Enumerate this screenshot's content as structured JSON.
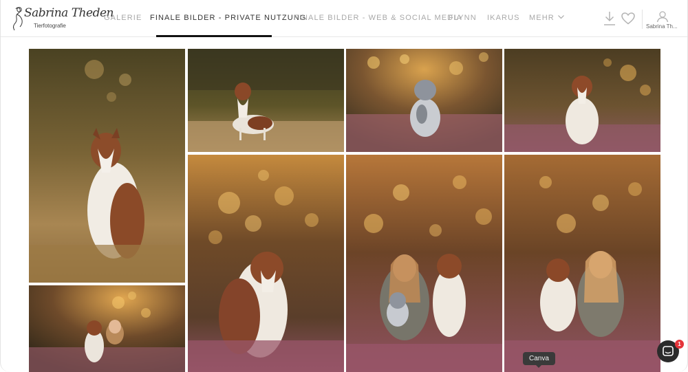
{
  "brand": {
    "name_script": "Sabrina Theden",
    "subtitle": "Tierfotografie"
  },
  "nav": {
    "items": [
      {
        "label": "GALERIE",
        "active": false
      },
      {
        "label": "FINALE BILDER - PRIVATE NUTZUNG",
        "active": true
      },
      {
        "label": "FINALE BILDER - WEB & SOCIAL MEDIA",
        "active": false
      },
      {
        "label": "FLYNN",
        "active": false
      },
      {
        "label": "IKARUS",
        "active": false
      },
      {
        "label": "MEHR",
        "active": false
      }
    ]
  },
  "header_actions": {
    "download_icon": "download-icon",
    "favorites_icon": "heart-icon",
    "user_icon": "user-icon",
    "user_name": "Sabrina Th..."
  },
  "colors": {
    "accent": "#111111",
    "nav_inactive": "#a8a8a8",
    "nav_active": "#333333",
    "chat_button": "#2b2b2b",
    "badge": "#e5343a"
  },
  "gallery": {
    "photos": [
      {
        "subject": "australian shepherd sitting in golden grass"
      },
      {
        "subject": "australian shepherd standing in meadow"
      },
      {
        "subject": "blue merle puppy in heather"
      },
      {
        "subject": "australian shepherd sitting in heather"
      },
      {
        "subject": "woman with dog in heather"
      },
      {
        "subject": "australian shepherd portrait with bokeh"
      },
      {
        "subject": "woman with puppy and dog in heather"
      },
      {
        "subject": "dog and woman sitting in heather"
      }
    ]
  },
  "tooltip": {
    "text": "Canva"
  },
  "chat": {
    "icon": "chat-icon",
    "badge_count": "1"
  }
}
